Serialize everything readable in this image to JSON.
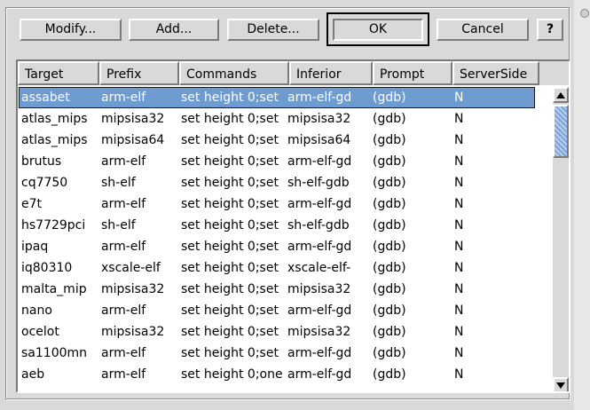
{
  "buttons": {
    "modify": "Modify...",
    "add": "Add...",
    "delete": "Delete...",
    "ok": "OK",
    "cancel": "Cancel",
    "help": "?"
  },
  "columns": [
    "Target",
    "Prefix",
    "Commands",
    "Inferior",
    "Prompt",
    "ServerSide"
  ],
  "rows": [
    [
      "assabet",
      "arm-elf",
      "set height 0;set",
      "arm-elf-gd",
      "(gdb)",
      "N"
    ],
    [
      "atlas_mips",
      "mipsisa32",
      "set height 0;set",
      "mipsisa32",
      "(gdb)",
      "N"
    ],
    [
      "atlas_mips",
      "mipsisa64",
      "set height 0;set",
      "mipsisa64",
      "(gdb)",
      "N"
    ],
    [
      "brutus",
      "arm-elf",
      "set height 0;set",
      "arm-elf-gd",
      "(gdb)",
      "N"
    ],
    [
      "cq7750",
      "sh-elf",
      "set height 0;set",
      "sh-elf-gdb",
      "(gdb)",
      "N"
    ],
    [
      "e7t",
      "arm-elf",
      "set height 0;set",
      "arm-elf-gd",
      "(gdb)",
      "N"
    ],
    [
      "hs7729pci",
      "sh-elf",
      "set height 0;set",
      "sh-elf-gdb",
      "(gdb)",
      "N"
    ],
    [
      "ipaq",
      "arm-elf",
      "set height 0;set",
      "arm-elf-gd",
      "(gdb)",
      "N"
    ],
    [
      "iq80310",
      "xscale-elf",
      "set height 0;set",
      "xscale-elf-",
      "(gdb)",
      "N"
    ],
    [
      "malta_mip",
      "mipsisa32",
      "set height 0;set",
      "mipsisa32",
      "(gdb)",
      "N"
    ],
    [
      "nano",
      "arm-elf",
      "set height 0;set",
      "arm-elf-gd",
      "(gdb)",
      "N"
    ],
    [
      "ocelot",
      "mipsisa32",
      "set height 0;set",
      "mipsisa32",
      "(gdb)",
      "N"
    ],
    [
      "sa1100mn",
      "arm-elf",
      "set height 0;set",
      "arm-elf-gd",
      "(gdb)",
      "N"
    ],
    [
      "aeb",
      "arm-elf",
      "set height 0;one",
      "arm-elf-gd",
      "(gdb)",
      "N"
    ]
  ],
  "selected_row": 0,
  "colors": {
    "selection": "#6e9bd0",
    "background": "#d9d9d9"
  }
}
